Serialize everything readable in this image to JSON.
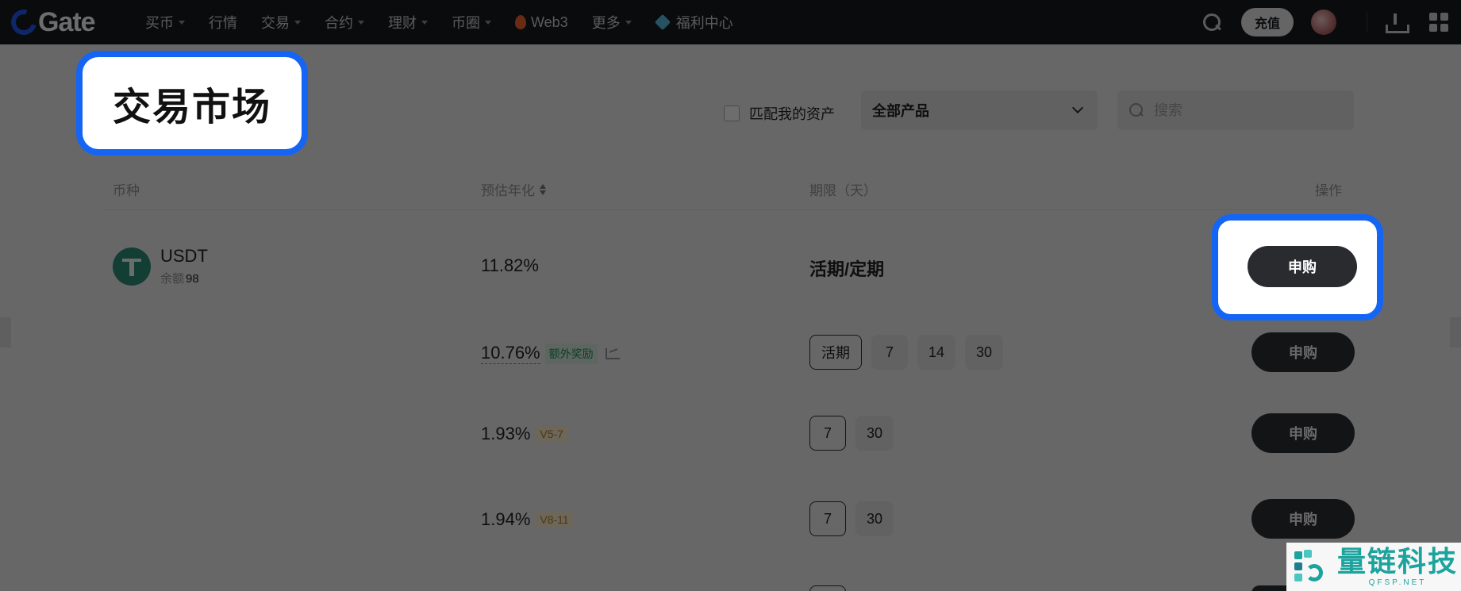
{
  "nav": {
    "logo": "Gate",
    "items": [
      {
        "label": "买币",
        "dropdown": true
      },
      {
        "label": "行情",
        "dropdown": false
      },
      {
        "label": "交易",
        "dropdown": true
      },
      {
        "label": "合约",
        "dropdown": true
      },
      {
        "label": "理财",
        "dropdown": true
      },
      {
        "label": "币圈",
        "dropdown": true
      },
      {
        "label": "Web3",
        "dropdown": false,
        "icon": "flame-icon"
      },
      {
        "label": "更多",
        "dropdown": true
      },
      {
        "label": "福利中心",
        "dropdown": false,
        "icon": "gift-cube-icon"
      }
    ],
    "deposit_label": "充值"
  },
  "page": {
    "title": "交易市场",
    "match_assets_label": "匹配我的资产",
    "product_select": "全部产品",
    "search_placeholder": "搜索"
  },
  "table": {
    "headers": {
      "coin": "币种",
      "apr": "预估年化",
      "term": "期限（天）",
      "action": "操作"
    },
    "coin": {
      "name": "USDT",
      "balance_label": "余额",
      "balance_value": "98"
    },
    "rows": [
      {
        "apr": "11.82%",
        "term_text": "活期/定期",
        "action": "申购"
      },
      {
        "apr": "10.76%",
        "badge": "额外奖励",
        "terms": [
          "活期",
          "7",
          "14",
          "30"
        ],
        "action": "申购"
      },
      {
        "apr": "1.93%",
        "badge": "V5-7",
        "terms": [
          "7",
          "30"
        ],
        "action": "申购"
      },
      {
        "apr": "1.94%",
        "badge": "V8-11",
        "terms": [
          "7",
          "30"
        ],
        "action": "申购"
      }
    ]
  },
  "watermark": {
    "cn": "量链科技",
    "en": "QFSP.NET"
  },
  "colors": {
    "highlight": "#1565f4",
    "nav_bg": "#17191e",
    "bonus_green": "#1f8b55",
    "vip_gold": "#b07a1e"
  }
}
